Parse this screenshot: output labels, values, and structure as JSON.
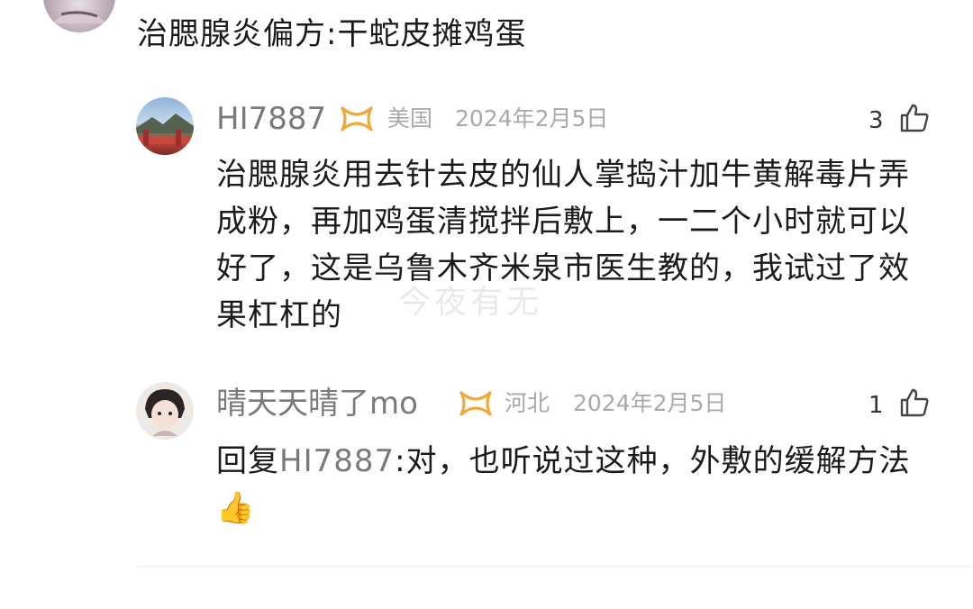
{
  "top_comment": {
    "text": "治腮腺炎偏方:干蛇皮摊鸡蛋"
  },
  "replies": [
    {
      "username": "HI7887",
      "badge_icon": "vip-ribbon-icon",
      "region": "美国",
      "date": "2024年2月5日",
      "like_count": "3",
      "text": "治腮腺炎用去针去皮的仙人掌捣汁加牛黄解毒片弄成粉，再加鸡蛋清搅拌后敷上，一二个小时就可以好了，这是乌鲁木齐米泉市医生教的，我试过了效果杠杠的"
    },
    {
      "username": "晴天天晴了mo",
      "badge_icon": "vip-ribbon-icon",
      "region": "河北",
      "date": "2024年2月5日",
      "like_count": "1",
      "reply_prefix": "回复",
      "reply_to": "HI7887",
      "text": ":对，也听说过这种，外敷的缓解方法👍"
    }
  ],
  "watermark": "今夜有无",
  "colors": {
    "text": "#1b1b1b",
    "username": "#7a7a7a",
    "meta": "#a9a9a9",
    "badge": "#f0a93b"
  }
}
